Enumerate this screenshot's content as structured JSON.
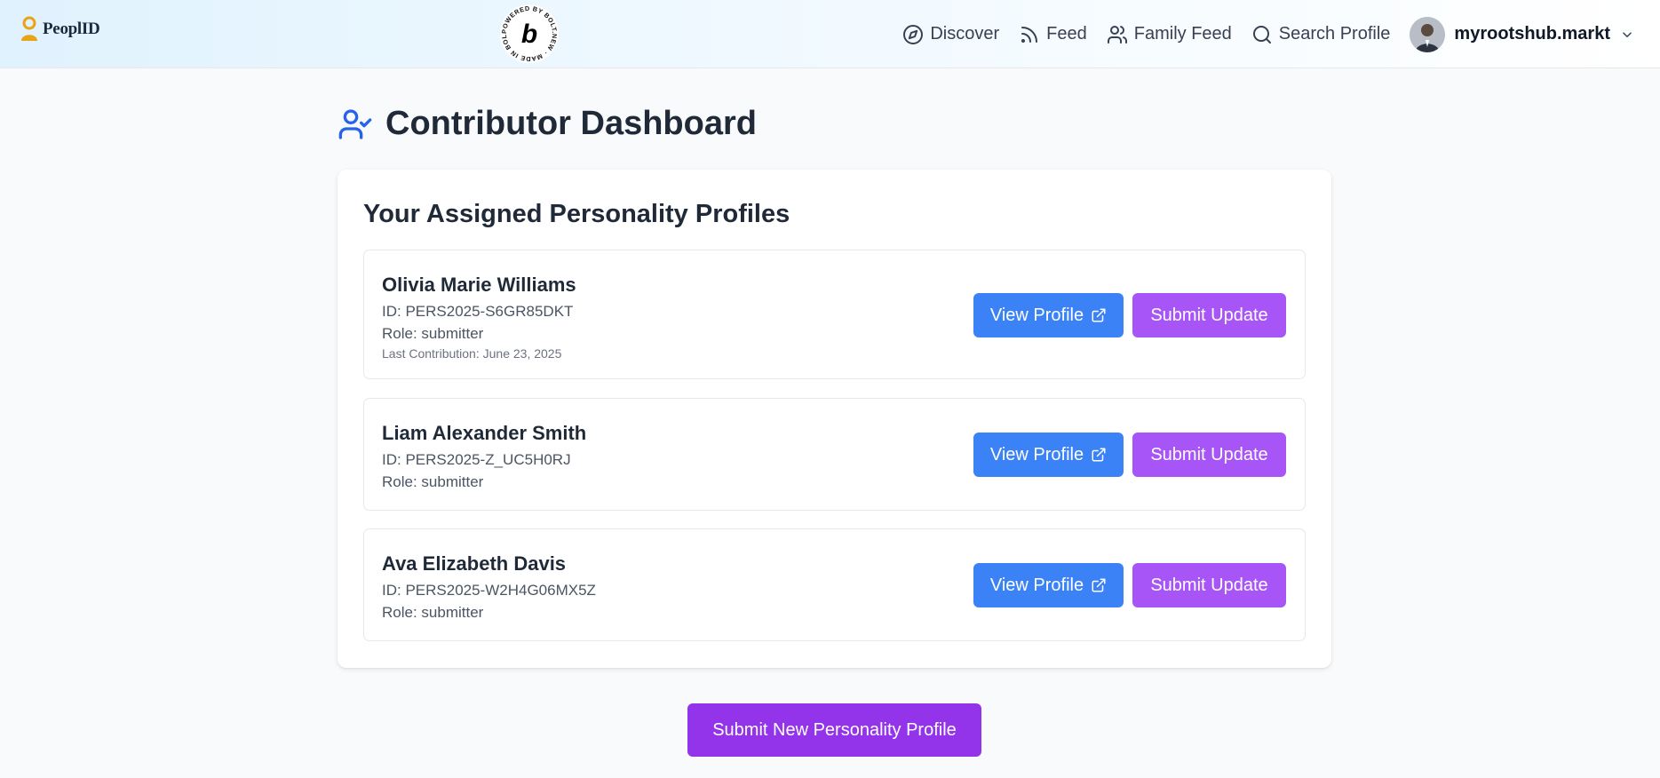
{
  "header": {
    "logo_text": "PeoplID",
    "badge_text": "POWERED BY BOLT.NEW · MADE IN BOLT.NEW ·",
    "badge_letter": "b",
    "nav": [
      {
        "label": "Discover",
        "icon": "compass-icon"
      },
      {
        "label": "Feed",
        "icon": "rss-icon"
      },
      {
        "label": "Family Feed",
        "icon": "users-icon"
      },
      {
        "label": "Search Profile",
        "icon": "search-icon"
      }
    ],
    "user": {
      "name": "myrootshub.markt"
    }
  },
  "page": {
    "title": "Contributor Dashboard"
  },
  "card": {
    "title": "Your Assigned Personality Profiles",
    "profiles": [
      {
        "name": "Olivia Marie Williams",
        "id": "ID: PERS2025-S6GR85DKT",
        "role": "Role: submitter",
        "last": "Last Contribution: June 23, 2025"
      },
      {
        "name": "Liam Alexander Smith",
        "id": "ID: PERS2025-Z_UC5H0RJ",
        "role": "Role: submitter"
      },
      {
        "name": "Ava Elizabeth Davis",
        "id": "ID: PERS2025-W2H4G06MX5Z",
        "role": "Role: submitter"
      }
    ],
    "view_label": "View Profile",
    "submit_label": "Submit Update"
  },
  "actions": {
    "new_profile_label": "Submit New Personality Profile"
  },
  "colors": {
    "accent_blue": "#3b82f6",
    "accent_purple": "#a855f7",
    "primary_purple": "#9333ea",
    "title_icon": "#2563eb"
  }
}
